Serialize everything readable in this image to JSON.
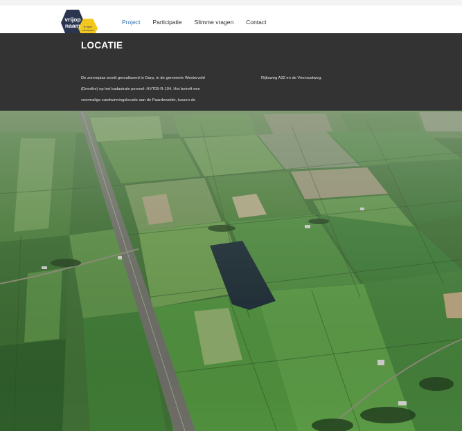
{
  "brand": {
    "logo_word_line1": "vrijop",
    "logo_word_line2": "naam",
    "logo_tagline_line1": "je eigen",
    "logo_tagline_line2": "zonnepark",
    "colors": {
      "dark": "#2b3550",
      "accent": "#f2c81e"
    }
  },
  "nav": {
    "items": [
      {
        "label": "Project",
        "active": true
      },
      {
        "label": "Participatie",
        "active": false
      },
      {
        "label": "Slimme vragen",
        "active": false
      },
      {
        "label": "Contact",
        "active": false
      }
    ]
  },
  "hero": {
    "title": "LOCATIE",
    "paragraph_col1_line1": "De zonnepias wordt gerealiseerd in Darp, in de gemeente Westerveld",
    "paragraph_col1_line2": "(Drenthe) op het kadastrale perceel: HVT05-R-104. Het betreft een",
    "paragraph_col1_line3": "voormalige zandwinningslocatie aan de Paardeweide, tussen de",
    "paragraph_col2_line1": "Rijksweg A32 en de Veenrustweg."
  },
  "image": {
    "icon": "aerial-photo-icon",
    "colors": {
      "field_dark": "#2e5a2a",
      "field_light": "#5f8f45",
      "water": "#1c2a35",
      "road": "#6d6d66"
    }
  }
}
